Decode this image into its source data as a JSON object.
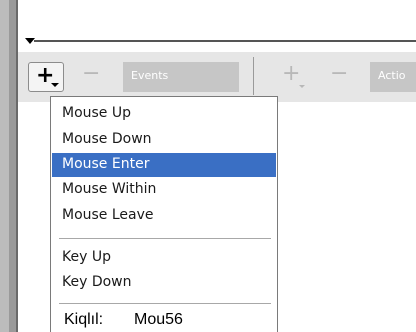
{
  "toolbar": {
    "add_symbol": "+",
    "remove_symbol": "−",
    "events_label": "Events",
    "actions_add_symbol": "+",
    "actions_remove_symbol": "−",
    "actions_label": "Actio"
  },
  "menu": {
    "mouse_items": [
      {
        "label": "Mouse Up",
        "selected": false
      },
      {
        "label": "Mouse Down",
        "selected": false
      },
      {
        "label": "Mouse Enter",
        "selected": true
      },
      {
        "label": "Mouse Within",
        "selected": false
      },
      {
        "label": "Mouse Leave",
        "selected": false
      }
    ],
    "key_items": [
      {
        "label": "Key Up",
        "selected": false
      },
      {
        "label": "Key Down",
        "selected": false
      }
    ]
  },
  "caption": {
    "prefix": "Kiqlıl:",
    "text": "Mou56"
  },
  "colors": {
    "selection": "#3a6fc4",
    "toolbar_field": "#c6c6c6"
  }
}
